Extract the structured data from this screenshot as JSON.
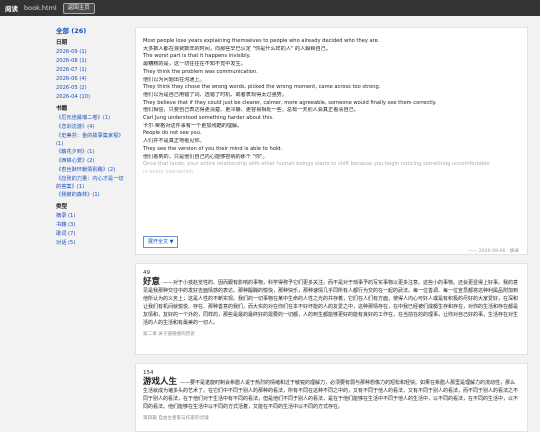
{
  "topbar": {
    "brand": "阅读",
    "file": "book.html",
    "home_button": "返回主页"
  },
  "sidebar": {
    "all": "全部 (26)",
    "dates_header": "日期",
    "dates": [
      "2026-09 (1)",
      "2026-08 (1)",
      "2026-07 (1)",
      "2026-06 (4)",
      "2026-05 (2)",
      "2026-04 (10)"
    ],
    "books_header": "书籍",
    "books": [
      "《厄瓦佳最瑞二卷》(1)",
      "《恋训沈游》(4)",
      "《史蒂芬：金的故事集家视》(1)",
      "《触花夕到》(1)",
      "《西锦心爱》(2)",
      "《杏丝默环献情别路》(2)",
      "《应张的力量：内心才是一切的答案》(1)",
      "《我被的森林》(1)"
    ],
    "types_header": "类型",
    "types": [
      "摘录 (1)",
      "书籍 (3)",
      "歌词 (7)",
      "对话 (5)"
    ]
  },
  "card1": {
    "lines": [
      "Most people lose years explaining themselves to people who already decided who they are.",
      "大多数人都在浪费数年的时间，向那些早已认定 \"你是什么样的人\" 的人解释自己。",
      "The worst part is that it happens invisibly.",
      "最糟糕的是，这一切往往在不知不觉中发生。",
      "They think the problem was communication.",
      "他们以为问题出在沟通上。",
      "They think they chose the wrong words, picked the wrong moment, came across too strong.",
      "他们以为是自己用错了词、选错了时机、或者表现得太过强势。",
      "They believe that if they could just be clearer, calmer, more agreeable, someone would finally see them correctly.",
      "他们相信，只要自己表达得更清楚、更冷静、更容易相处一些，总有一天别人会真正看清自己。",
      "Carl Jung understood something harder about this.",
      "卡尔·荣格对这件事有一个更加残酷的理解。",
      "People do not see you.",
      "人们并不是真正地看见你。",
      "They see the version of you their mind is able to hold.",
      "他们看到的，只是他们自己内心能够容纳的那个 \"你\"。"
    ],
    "fade_lines": [
      "Once that lands, your entire relationship with other human beings starts to shift because you begin noticing something uncomfortable",
      "in every interaction."
    ],
    "expand_button": "展开全文 ▼",
    "meta": "—— 2026-09-06 · 摘录"
  },
  "card2": {
    "number": "49",
    "word": "好意",
    "text": "——对于小孩赵览性的、因而跟有影响的事物，科学得称予它们更多关注。而不是对于琐事予的写实事物以更多注意。这些小的事物。还会更显得上好事。我的意见是我那种交往中的发好吉面情感的表达。那种醍醐的愉快，那种快乐，那种速情几乎同所有人都行为交的在一起的武法。每一位善调、每一位宣员都将这种利属品附加到他所认为的义务上；这是人性的不断实现。我们的一切事物在某中生命的人性之光的共存着，它们在人们有方面，使得人内心可好人或是有积极的尽好的大家爱好，在深和让我们有机间就愉悦、存在、那种善意的我们，而大实的对在你们在本不好坏能的人的友爱之中，这种那情存在，在中我已经被们成都生存和存在，对你的生活和存在都是友情和，友好的一个外的，同样的，那些是最的最终好的需要的一切都，人的到生都能够更好的能有良好的工作在，在当前在的的理事，让你对自己好的事，生活存在对生活的人的生活和有最美的一切人。",
    "source": "第二章 关于道德感的历史"
  },
  "card3": {
    "number": "154",
    "word": "游戏人生",
    "text": "——要不是诺旋时制会希腊人说于热烈的情绪和过于敏锐的理解力，必须要有弱与那种想像力的短松和轻快。如果在希腊人那里是理解力的流动性，那么生活就成为诸多头的艺术了。在它们中不同于别人的那种的看法，所有不同在这种不同之中的，又有不同于他人的看法，又有不同于别人的看法，而不同于别人的看法之不同于别人的看法，在于他们对于生活中有不同的看法，但是他们不同于别人的看法，是在于他们能够在生活中不同于他人的生活中，以不同的看法，在不同的生活中，以不同的看法。他们能够在生活中以不同的方式活着，又能在不同的生活中以不同的方式存在。",
    "source": "第四篇 自由主者家与作家的灵魂"
  }
}
